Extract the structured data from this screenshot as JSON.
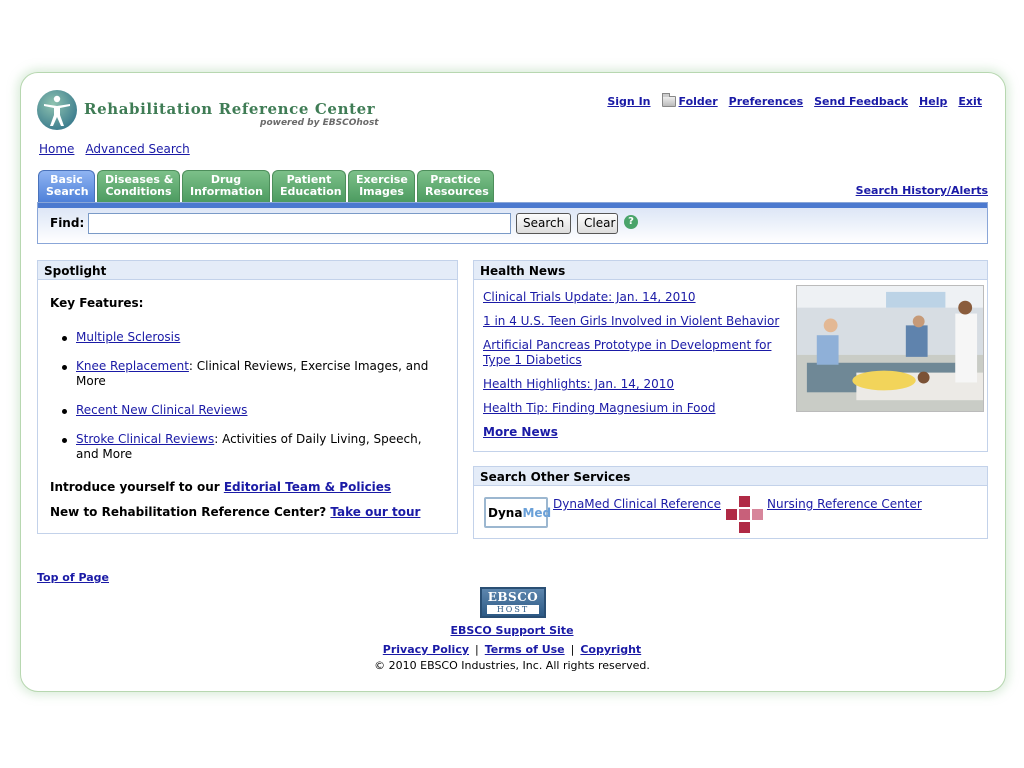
{
  "brand": {
    "name": "Rehabilitation Reference Center",
    "powered_by": "powered by EBSCOhost"
  },
  "top_links": {
    "sign_in": "Sign In",
    "folder": "Folder",
    "preferences": "Preferences",
    "send_feedback": "Send Feedback",
    "help": "Help",
    "exit": "Exit"
  },
  "subnav": {
    "home": "Home",
    "advanced_search": "Advanced Search"
  },
  "tabs": [
    {
      "line1": "Basic",
      "line2": "Search",
      "active": true
    },
    {
      "line1": "Diseases &",
      "line2": "Conditions",
      "active": false
    },
    {
      "line1": "Drug",
      "line2": "Information",
      "active": false
    },
    {
      "line1": "Patient",
      "line2": "Education",
      "active": false
    },
    {
      "line1": "Exercise",
      "line2": "Images",
      "active": false
    },
    {
      "line1": "Practice",
      "line2": "Resources",
      "active": false
    }
  ],
  "search_history": "Search History/Alerts",
  "search": {
    "find_label": "Find:",
    "value": "",
    "search_button": "Search",
    "clear_button": "Clear",
    "help_icon": "?"
  },
  "spotlight": {
    "title": "Spotlight",
    "key_features": "Key Features:",
    "items": [
      {
        "link": "Multiple Sclerosis",
        "rest": ""
      },
      {
        "link": "Knee Replacement",
        "rest": ": Clinical Reviews, Exercise Images, and More"
      },
      {
        "link": "Recent New Clinical Reviews",
        "rest": ""
      },
      {
        "link": "Stroke Clinical Reviews",
        "rest": ": Activities of Daily Living, Speech, and More"
      }
    ],
    "intro_text": "Introduce yourself to our ",
    "intro_link": "Editorial Team & Policies",
    "new_text": "New to Rehabilitation Reference Center? ",
    "new_link": "Take our tour"
  },
  "health_news": {
    "title": "Health News",
    "items": [
      "Clinical Trials Update: Jan. 14, 2010",
      "1 in 4 U.S. Teen Girls Involved in Violent Behavior",
      "Artificial Pancreas Prototype in Development for Type 1 Diabetics",
      "Health Highlights: Jan. 14, 2010",
      "Health Tip: Finding Magnesium in Food"
    ],
    "more": "More News"
  },
  "other_services": {
    "title": "Search Other Services",
    "dyna_logo_a": "Dyna",
    "dyna_logo_b": "Med",
    "dynamed": "DynaMed Clinical Reference",
    "nursing": "Nursing Reference Center"
  },
  "footer": {
    "top_of_page": "Top of Page",
    "ebsco_logo_top": "EBSCO",
    "ebsco_logo_bottom": "HOST",
    "support": "EBSCO Support Site",
    "privacy": "Privacy Policy",
    "terms": "Terms of Use",
    "copyright_link": "Copyright",
    "copyright": "© 2010 EBSCO Industries, Inc. All rights reserved."
  },
  "colors": {
    "brand_green": "#3f7c55",
    "tab_green": "#4b9a5f",
    "tab_active_blue": "#4d7fd8",
    "link_blue": "#1a1aa6",
    "panel_head": "#e4ecf8"
  }
}
